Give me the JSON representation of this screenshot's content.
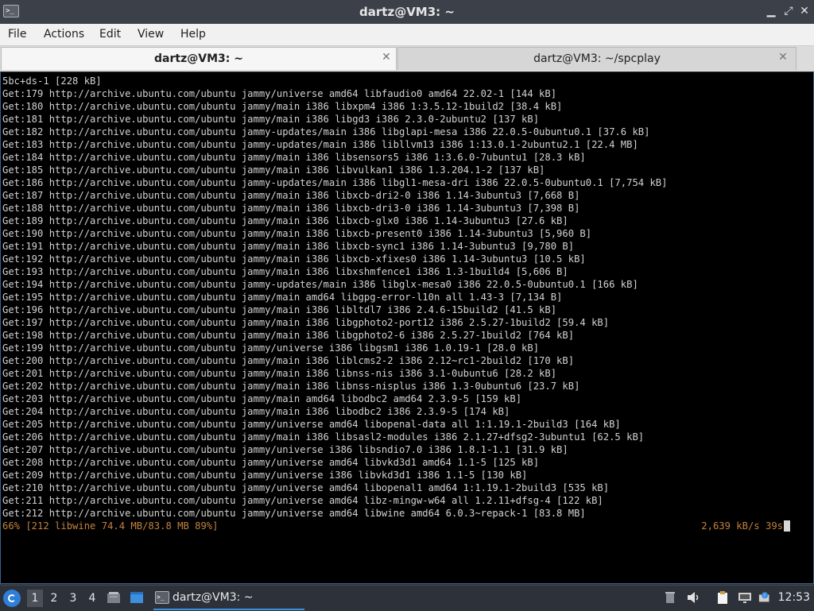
{
  "window": {
    "title": "dartz@VM3: ~",
    "minimize_symbol": "▁",
    "maximize_symbol": "⤢",
    "close_symbol": "✕"
  },
  "menu": [
    "File",
    "Actions",
    "Edit",
    "View",
    "Help"
  ],
  "tabs": [
    {
      "label": "dartz@VM3: ~",
      "active": true
    },
    {
      "label": "dartz@VM3: ~/spcplay",
      "active": false
    }
  ],
  "terminal": {
    "lines": [
      "5bc+ds-1 [228 kB]",
      "Get:179 http://archive.ubuntu.com/ubuntu jammy/universe amd64 libfaudio0 amd64 22.02-1 [144 kB]",
      "Get:180 http://archive.ubuntu.com/ubuntu jammy/main i386 libxpm4 i386 1:3.5.12-1build2 [38.4 kB]",
      "Get:181 http://archive.ubuntu.com/ubuntu jammy/main i386 libgd3 i386 2.3.0-2ubuntu2 [137 kB]",
      "Get:182 http://archive.ubuntu.com/ubuntu jammy-updates/main i386 libglapi-mesa i386 22.0.5-0ubuntu0.1 [37.6 kB]",
      "Get:183 http://archive.ubuntu.com/ubuntu jammy-updates/main i386 libllvm13 i386 1:13.0.1-2ubuntu2.1 [22.4 MB]",
      "Get:184 http://archive.ubuntu.com/ubuntu jammy/main i386 libsensors5 i386 1:3.6.0-7ubuntu1 [28.3 kB]",
      "Get:185 http://archive.ubuntu.com/ubuntu jammy/main i386 libvulkan1 i386 1.3.204.1-2 [137 kB]",
      "Get:186 http://archive.ubuntu.com/ubuntu jammy-updates/main i386 libgl1-mesa-dri i386 22.0.5-0ubuntu0.1 [7,754 kB]",
      "Get:187 http://archive.ubuntu.com/ubuntu jammy/main i386 libxcb-dri2-0 i386 1.14-3ubuntu3 [7,668 B]",
      "Get:188 http://archive.ubuntu.com/ubuntu jammy/main i386 libxcb-dri3-0 i386 1.14-3ubuntu3 [7,398 B]",
      "Get:189 http://archive.ubuntu.com/ubuntu jammy/main i386 libxcb-glx0 i386 1.14-3ubuntu3 [27.6 kB]",
      "Get:190 http://archive.ubuntu.com/ubuntu jammy/main i386 libxcb-present0 i386 1.14-3ubuntu3 [5,960 B]",
      "Get:191 http://archive.ubuntu.com/ubuntu jammy/main i386 libxcb-sync1 i386 1.14-3ubuntu3 [9,780 B]",
      "Get:192 http://archive.ubuntu.com/ubuntu jammy/main i386 libxcb-xfixes0 i386 1.14-3ubuntu3 [10.5 kB]",
      "Get:193 http://archive.ubuntu.com/ubuntu jammy/main i386 libxshmfence1 i386 1.3-1build4 [5,606 B]",
      "Get:194 http://archive.ubuntu.com/ubuntu jammy-updates/main i386 libglx-mesa0 i386 22.0.5-0ubuntu0.1 [166 kB]",
      "Get:195 http://archive.ubuntu.com/ubuntu jammy/main amd64 libgpg-error-l10n all 1.43-3 [7,134 B]",
      "Get:196 http://archive.ubuntu.com/ubuntu jammy/main i386 libltdl7 i386 2.4.6-15build2 [41.5 kB]",
      "Get:197 http://archive.ubuntu.com/ubuntu jammy/main i386 libgphoto2-port12 i386 2.5.27-1build2 [59.4 kB]",
      "Get:198 http://archive.ubuntu.com/ubuntu jammy/main i386 libgphoto2-6 i386 2.5.27-1build2 [764 kB]",
      "Get:199 http://archive.ubuntu.com/ubuntu jammy/universe i386 libgsm1 i386 1.0.19-1 [28.0 kB]",
      "Get:200 http://archive.ubuntu.com/ubuntu jammy/main i386 liblcms2-2 i386 2.12~rc1-2build2 [170 kB]",
      "Get:201 http://archive.ubuntu.com/ubuntu jammy/main i386 libnss-nis i386 3.1-0ubuntu6 [28.2 kB]",
      "Get:202 http://archive.ubuntu.com/ubuntu jammy/main i386 libnss-nisplus i386 1.3-0ubuntu6 [23.7 kB]",
      "Get:203 http://archive.ubuntu.com/ubuntu jammy/main amd64 libodbc2 amd64 2.3.9-5 [159 kB]",
      "Get:204 http://archive.ubuntu.com/ubuntu jammy/main i386 libodbc2 i386 2.3.9-5 [174 kB]",
      "Get:205 http://archive.ubuntu.com/ubuntu jammy/universe amd64 libopenal-data all 1:1.19.1-2build3 [164 kB]",
      "Get:206 http://archive.ubuntu.com/ubuntu jammy/main i386 libsasl2-modules i386 2.1.27+dfsg2-3ubuntu1 [62.5 kB]",
      "Get:207 http://archive.ubuntu.com/ubuntu jammy/universe i386 libsndio7.0 i386 1.8.1-1.1 [31.9 kB]",
      "Get:208 http://archive.ubuntu.com/ubuntu jammy/universe amd64 libvkd3d1 amd64 1.1-5 [125 kB]",
      "Get:209 http://archive.ubuntu.com/ubuntu jammy/universe i386 libvkd3d1 i386 1.1-5 [130 kB]",
      "Get:210 http://archive.ubuntu.com/ubuntu jammy/universe amd64 libopenal1 amd64 1:1.19.1-2build3 [535 kB]",
      "Get:211 http://archive.ubuntu.com/ubuntu jammy/universe amd64 libz-mingw-w64 all 1.2.11+dfsg-4 [122 kB]",
      "Get:212 http://archive.ubuntu.com/ubuntu jammy/universe amd64 libwine amd64 6.0.3~repack-1 [83.8 MB]"
    ],
    "progress_left": "66% [212 libwine 74.4 MB/83.8 MB 89%]",
    "progress_right": "2,639 kB/s 39s",
    "progress_color": "#c4823c"
  },
  "taskbar": {
    "workspaces": [
      "1",
      "2",
      "3",
      "4"
    ],
    "active_workspace": "1",
    "task_label": "dartz@VM3: ~",
    "clock": "12:53"
  }
}
